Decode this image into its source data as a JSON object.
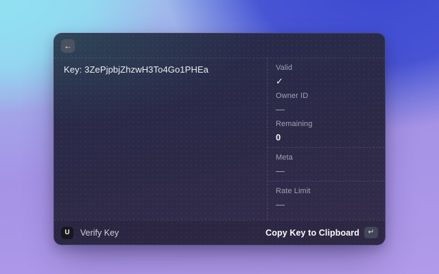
{
  "header": {
    "back_icon": "←"
  },
  "main": {
    "key_line": "Key: 3ZePjpbjZhzwH3To4Go1PHEa"
  },
  "details": {
    "sections": [
      {
        "fields": [
          {
            "label": "Valid",
            "value": "✓"
          },
          {
            "label": "Owner ID",
            "value": "—"
          },
          {
            "label": "Remaining",
            "value": "0"
          }
        ]
      },
      {
        "fields": [
          {
            "label": "Meta",
            "value": "—"
          }
        ]
      },
      {
        "fields": [
          {
            "label": "Rate Limit",
            "value": "—"
          }
        ]
      }
    ]
  },
  "footer": {
    "brand_initial": "U",
    "verify_label": "Verify Key",
    "copy_label": "Copy Key to Clipboard",
    "enter_symbol": "↵"
  },
  "colors": {
    "background_top_left": "#8fe2f2",
    "background_top_right": "#3b48d1",
    "background_bottom": "#ae97e8",
    "card_base": "#2c2947",
    "valid_check": "#f2f3f6"
  }
}
